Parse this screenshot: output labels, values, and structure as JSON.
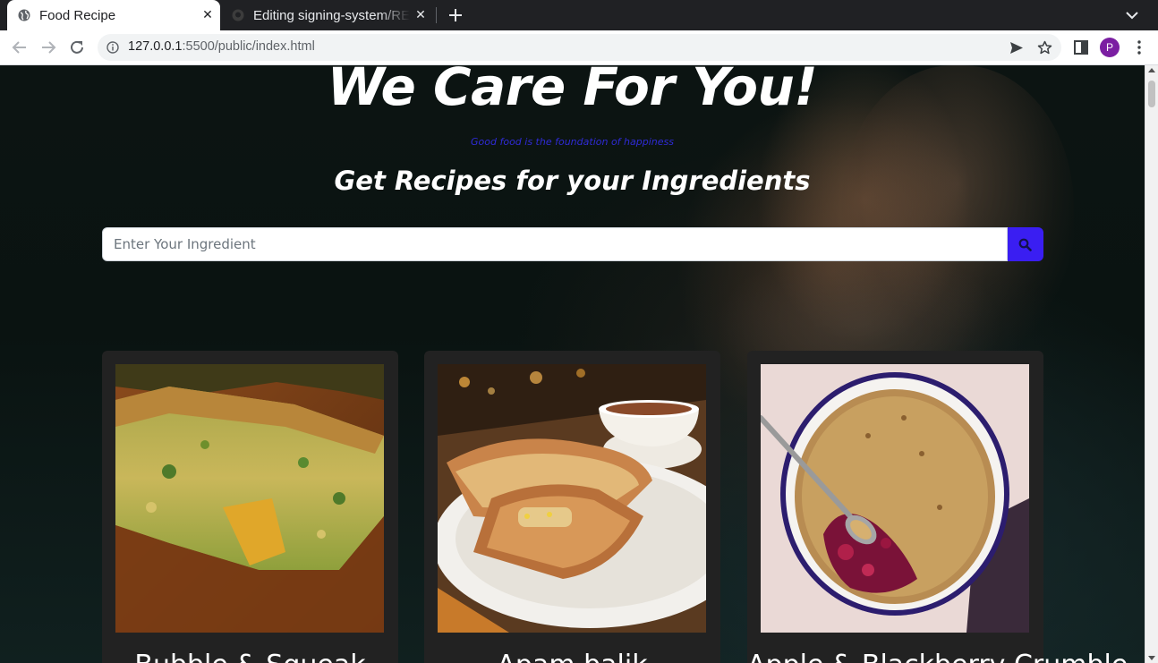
{
  "browser": {
    "tabs": [
      {
        "title": "Food Recipe",
        "active": true,
        "icon": "globe-icon"
      },
      {
        "title": "Editing signing-system/README",
        "active": false,
        "icon": "github-icon"
      }
    ],
    "url_host": "127.0.0.1",
    "url_rest": ":5500/public/index.html",
    "profile_initial": "P",
    "profile_color": "#7b1fa2"
  },
  "hero": {
    "headline": "We Care For You!",
    "tagline": "Good food is the foundation of happiness",
    "subheadline": "Get Recipes for your Ingredients"
  },
  "search": {
    "placeholder": "Enter Your Ingredient",
    "value": "",
    "button_icon": "search-icon",
    "button_color": "#3a1ef2"
  },
  "recipes": [
    {
      "title": "Bubble & Squeak",
      "image": "savory-bake-photo"
    },
    {
      "title": "Apam balik",
      "image": "pancake-turnover-photo"
    },
    {
      "title": "Apple & Blackberry Crumble",
      "image": "berry-crumble-photo"
    }
  ]
}
